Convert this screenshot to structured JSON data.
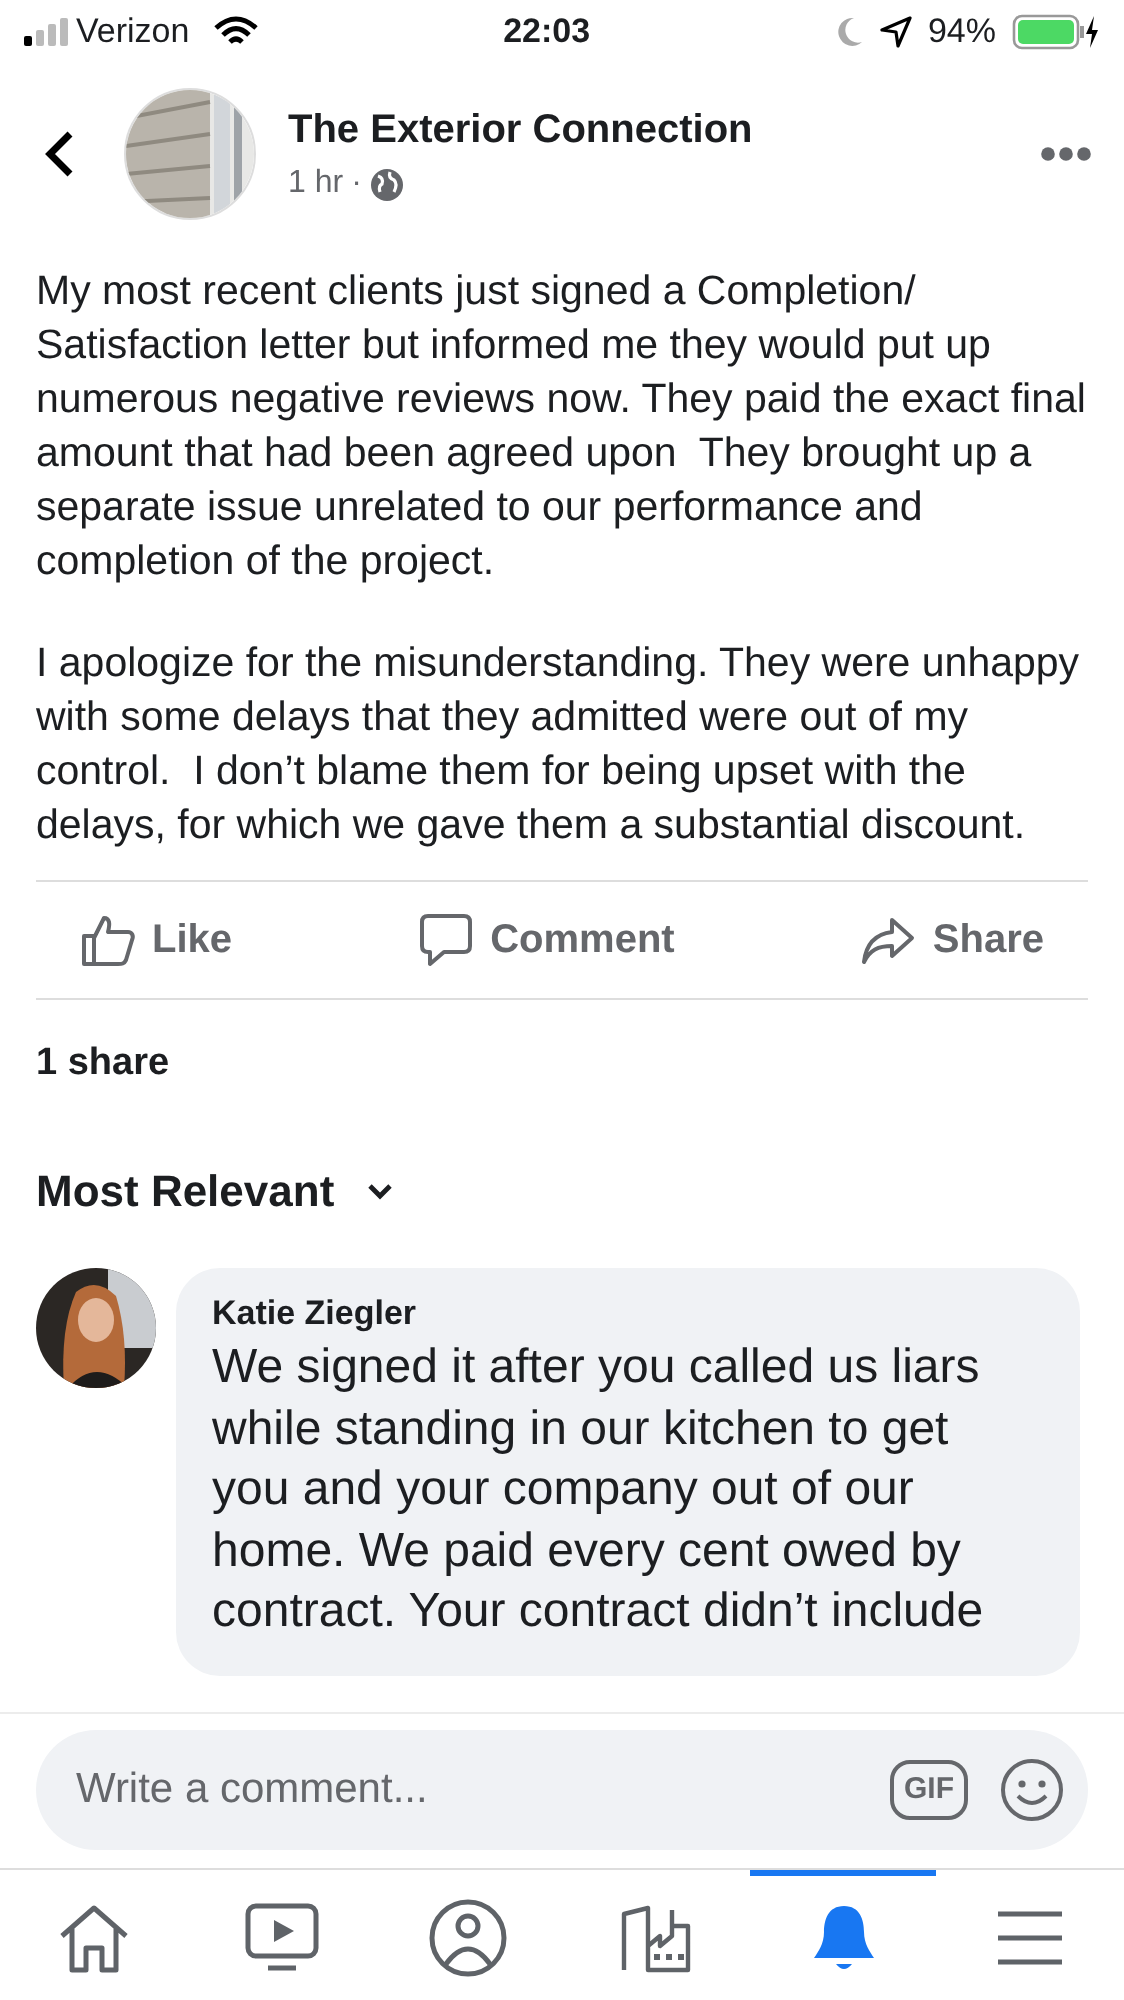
{
  "status_bar": {
    "carrier": "Verizon",
    "time": "22:03",
    "battery": "94%"
  },
  "post": {
    "page_name": "The Exterior Connection",
    "time": "1 hr",
    "separator": "·",
    "paragraphs": [
      "My most recent clients just signed a Completion/ Satisfaction letter but informed me they would put up numerous negative reviews now. They paid the exact final amount that had been agreed upon  They brought up a separate issue unrelated to our performance and completion of the project.",
      "I apologize for the misunderstanding. They were unhappy with some delays that they admitted were out of my control.  I don’t blame them for being upset with the delays, for which we gave them a substantial discount."
    ],
    "actions": [
      {
        "kind": "like",
        "label": "Like"
      },
      {
        "kind": "comment",
        "label": "Comment"
      },
      {
        "kind": "share",
        "label": "Share"
      }
    ],
    "shares": "1 share"
  },
  "comments": {
    "sort_label": "Most Relevant",
    "items": [
      {
        "author": "Katie Ziegler",
        "lines": [
          "We signed it after you called us liars",
          "while standing in our kitchen to get",
          "you and your company out of our",
          "home. We paid every cent owed by",
          "contract. Your contract didn’t include"
        ]
      }
    ]
  },
  "composer": {
    "placeholder": "Write a comment...",
    "gif": "GIF"
  },
  "tab_bar": [
    {
      "kind": "home",
      "selected": false
    },
    {
      "kind": "video",
      "selected": false
    },
    {
      "kind": "profile",
      "selected": false
    },
    {
      "kind": "pages",
      "selected": false
    },
    {
      "kind": "notifications",
      "selected": true
    },
    {
      "kind": "menu",
      "selected": false
    }
  ]
}
